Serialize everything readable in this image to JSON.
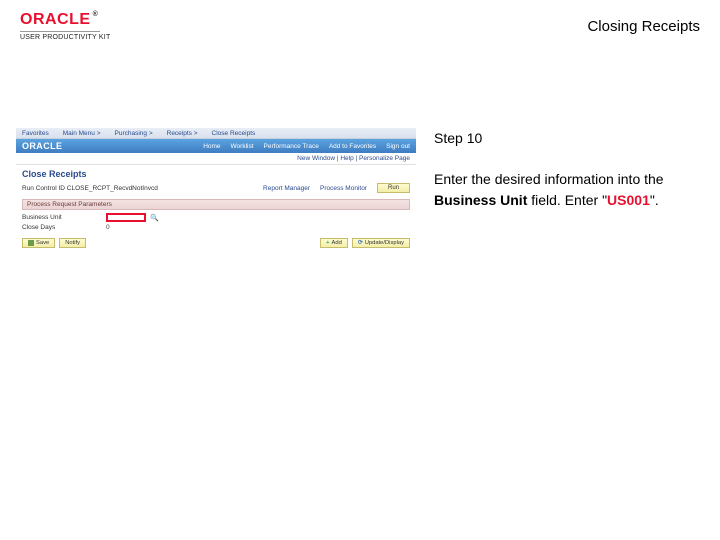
{
  "header": {
    "brand": "ORACLE",
    "trademark": "®",
    "product": "USER PRODUCTIVITY KIT",
    "title": "Closing Receipts"
  },
  "screenshot": {
    "nav": [
      "Favorites",
      "Main Menu >",
      "Purchasing >",
      "Receipts >",
      "Close Receipts"
    ],
    "brand_small": "ORACLE",
    "top_links": [
      "Home",
      "Worklist",
      "Performance Trace",
      "Add to Favorites",
      "Sign out"
    ],
    "crumb": "New Window | Help | Personalize Page",
    "page_title": "Close Receipts",
    "run_control_label": "Run Control ID  CLOSE_RCPT_RecvdNotInvcd",
    "report_mgr": "Report Manager",
    "process_mon": "Process Monitor",
    "run_btn": "Run",
    "section": "Process Request Parameters",
    "fields": {
      "bu_label": "Business Unit",
      "hl_label": "highlighted Business Unit input",
      "close_days_label": "Close Days",
      "close_days_val": "0"
    },
    "buttons": {
      "save": "Save",
      "notify": "Notify",
      "add": "Add",
      "update": "Update/Display"
    }
  },
  "instruction": {
    "step_label": "Step 10",
    "text_lead": "Enter the desired information into the ",
    "text_bold": "Business Unit",
    "text_mid": " field. Enter \"",
    "code": "US001",
    "text_tail": "\"."
  }
}
